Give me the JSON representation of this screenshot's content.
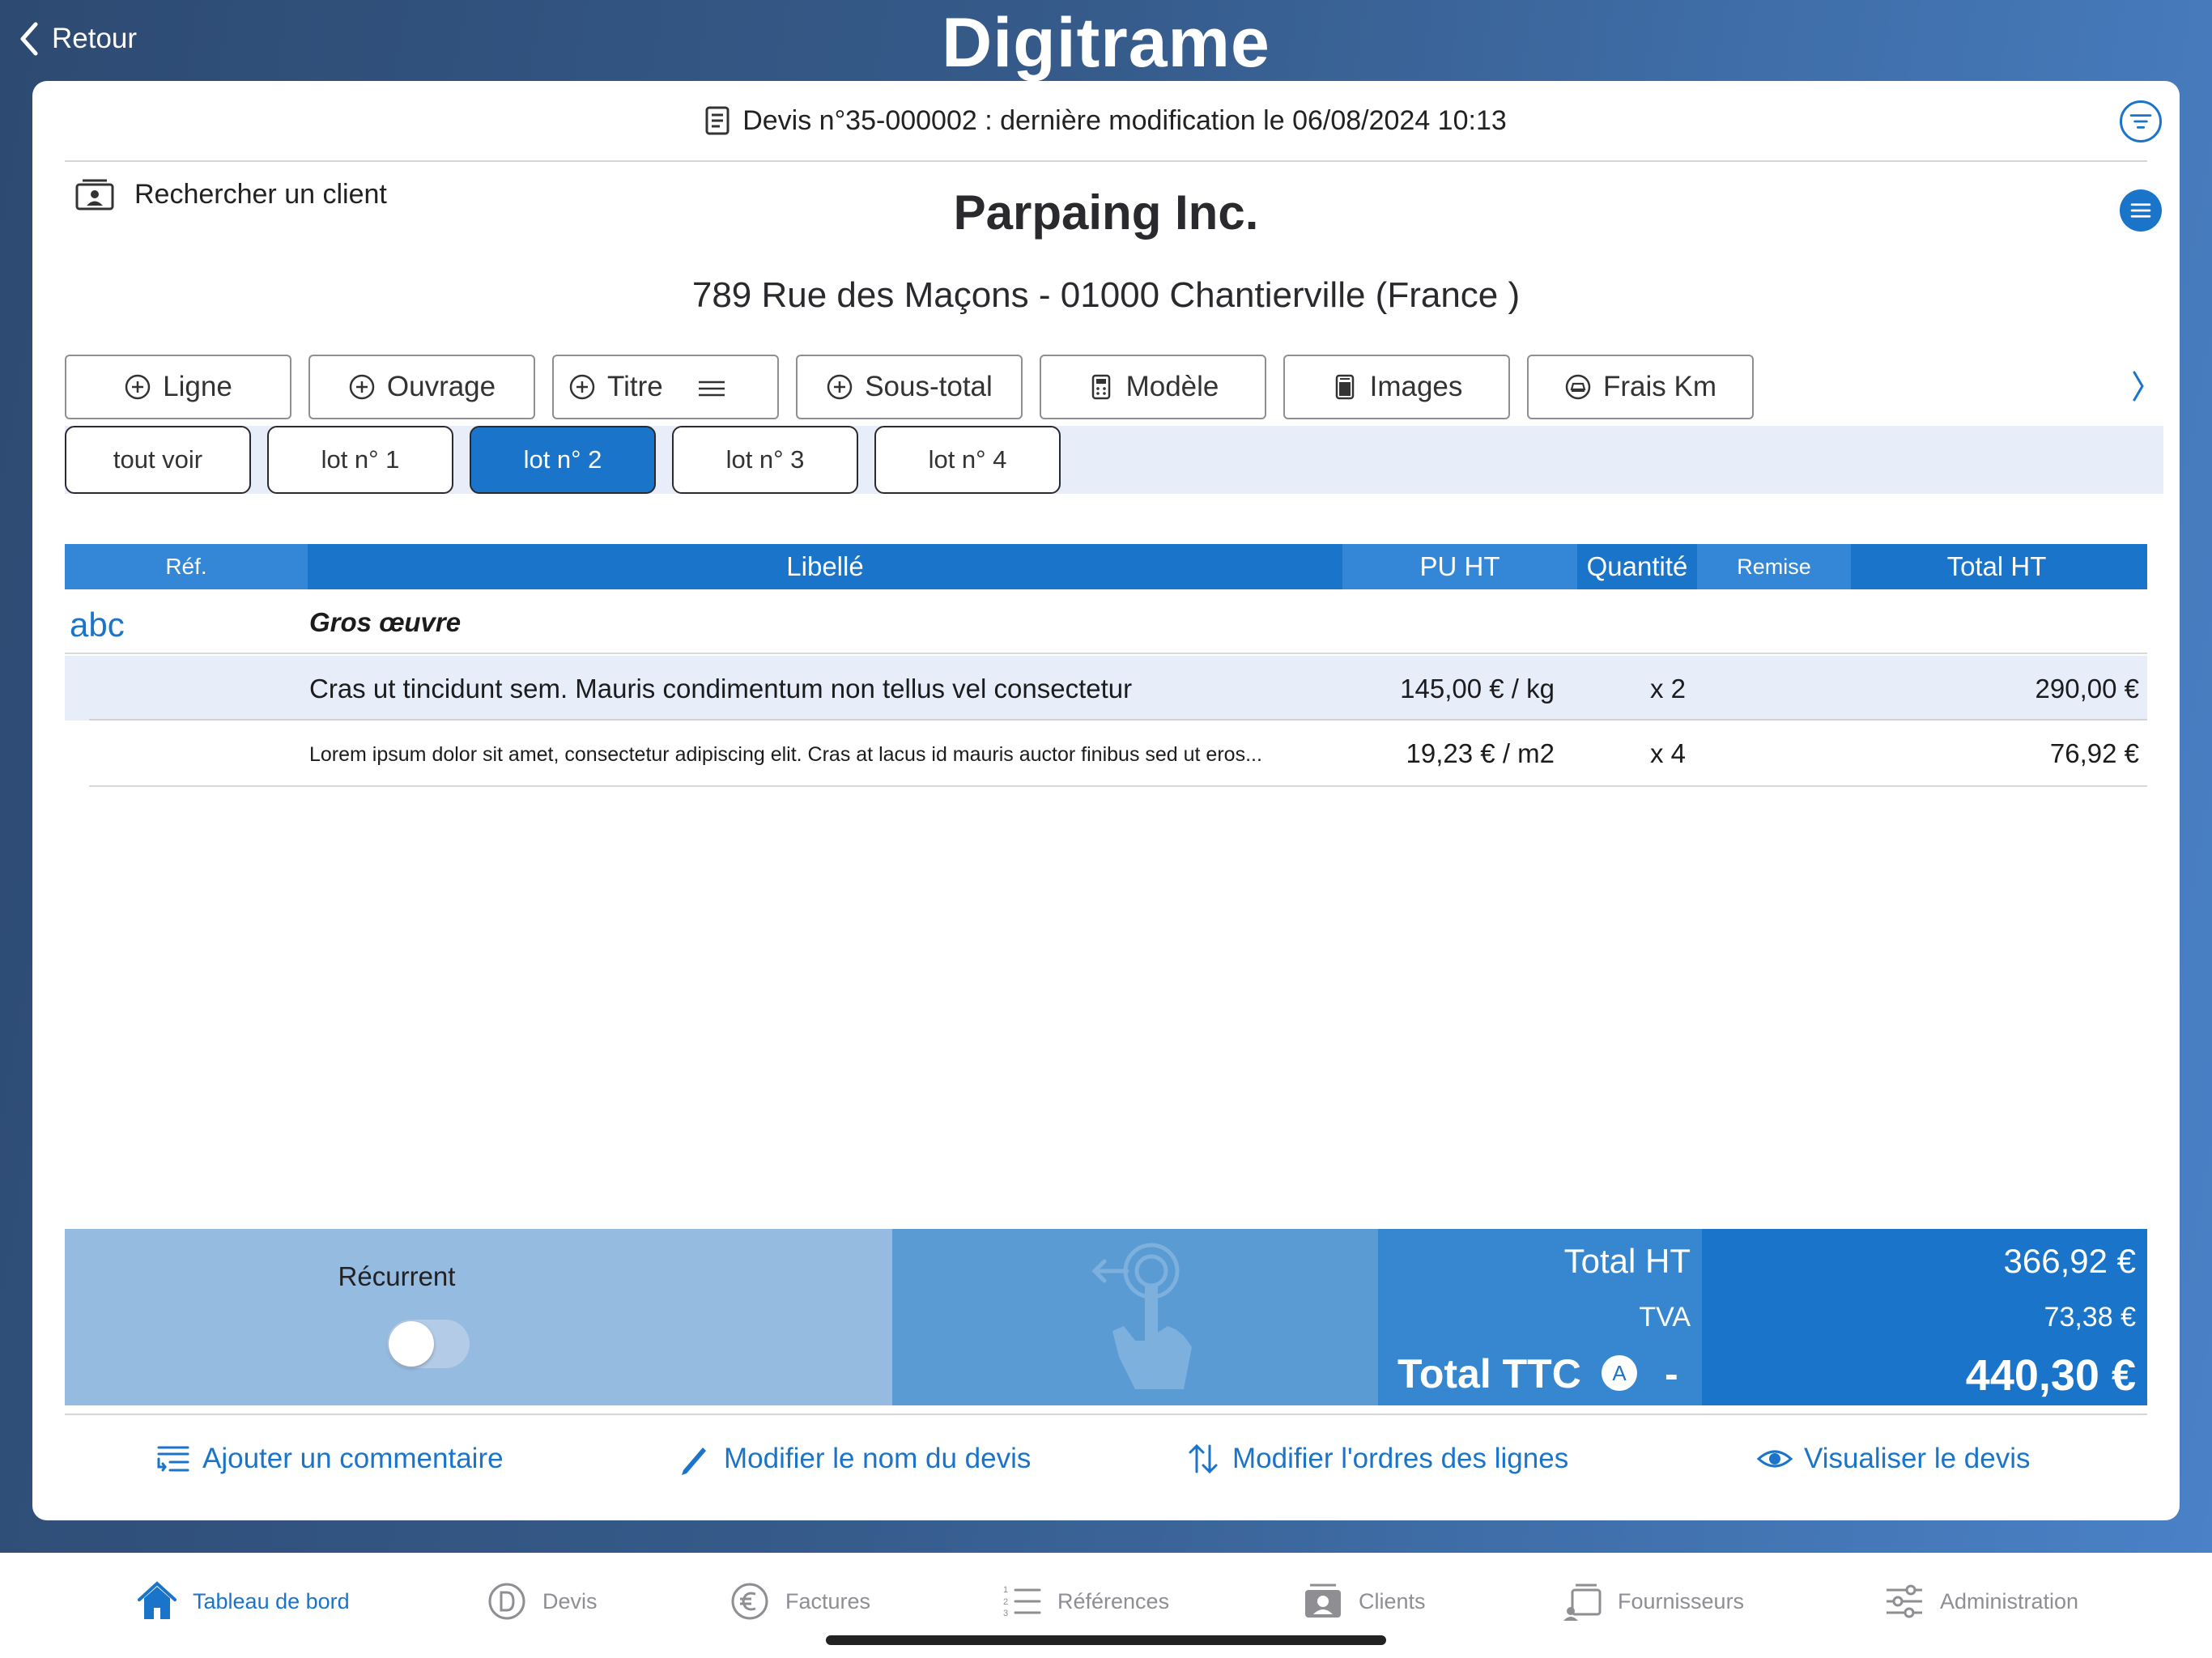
{
  "nav": {
    "back_label": "Retour",
    "logo": "Digitrame"
  },
  "header": {
    "title": "Devis n°35-000002 : dernière modification le 06/08/2024 10:13"
  },
  "client": {
    "search_label": "Rechercher un client",
    "name": "Parpaing Inc.",
    "address": "789 Rue des Maçons - 01000 Chantierville (France )"
  },
  "actions": [
    {
      "label": "Ligne",
      "icon": "plus-circle-icon"
    },
    {
      "label": "Ouvrage",
      "icon": "plus-circle-icon"
    },
    {
      "label": "Titre",
      "icon": "plus-circle-icon"
    },
    {
      "label": "Sous-total",
      "icon": "plus-circle-icon"
    },
    {
      "label": "Modèle",
      "icon": "calculator-icon"
    },
    {
      "label": "Images",
      "icon": "image-icon"
    },
    {
      "label": "Frais Km",
      "icon": "car-icon"
    }
  ],
  "lots": [
    "tout voir",
    "lot n° 1",
    "lot n° 2",
    "lot n° 3",
    "lot n° 4"
  ],
  "active_lot": "lot n° 2",
  "table": {
    "columns": [
      "Réf.",
      "Libellé",
      "PU HT",
      "Quantité",
      "Remise",
      "Total HT"
    ],
    "title_row": {
      "ref": "abc",
      "label": "Gros œuvre"
    },
    "rows": [
      {
        "label": "Cras ut tincidunt sem. Mauris condimentum non tellus vel consectetur",
        "pu": "145,00 € / kg",
        "qty": "x 2",
        "total": "290,00 €"
      },
      {
        "label": "Lorem ipsum dolor sit amet, consectetur adipiscing elit. Cras at lacus id mauris auctor finibus sed ut eros...",
        "pu": "19,23 € / m2",
        "qty": "x 4",
        "total": "76,92 €"
      }
    ]
  },
  "totals": {
    "recurrent_label": "Récurrent",
    "recurrent_on": false,
    "total_ht_label": "Total HT",
    "total_ht": "366,92 €",
    "tva_label": "TVA",
    "tva": "73,38 €",
    "total_ttc_label": "Total TTC",
    "ttc_badge": "A",
    "ttc_dash": "-",
    "total_ttc": "440,30 €"
  },
  "bottom_actions": [
    {
      "label": "Ajouter un commentaire",
      "icon": "comment-list-icon"
    },
    {
      "label": "Modifier le nom du devis",
      "icon": "pencil-icon"
    },
    {
      "label": "Modifier l'ordres des lignes",
      "icon": "sort-arrows-icon"
    },
    {
      "label": "Visualiser le devis",
      "icon": "eye-icon"
    }
  ],
  "tabbar": [
    {
      "label": "Tableau de bord",
      "icon": "home-icon",
      "active": true
    },
    {
      "label": "Devis",
      "icon": "devis-icon",
      "active": false
    },
    {
      "label": "Factures",
      "icon": "euro-icon",
      "active": false
    },
    {
      "label": "Références",
      "icon": "numbered-list-icon",
      "active": false
    },
    {
      "label": "Clients",
      "icon": "client-icon",
      "active": false
    },
    {
      "label": "Fournisseurs",
      "icon": "supplier-icon",
      "active": false
    },
    {
      "label": "Administration",
      "icon": "sliders-icon",
      "active": false
    }
  ],
  "colors": {
    "accent": "#1a74c9",
    "row_highlight": "#e7eefa",
    "tab_inactive": "#8e8e93"
  }
}
